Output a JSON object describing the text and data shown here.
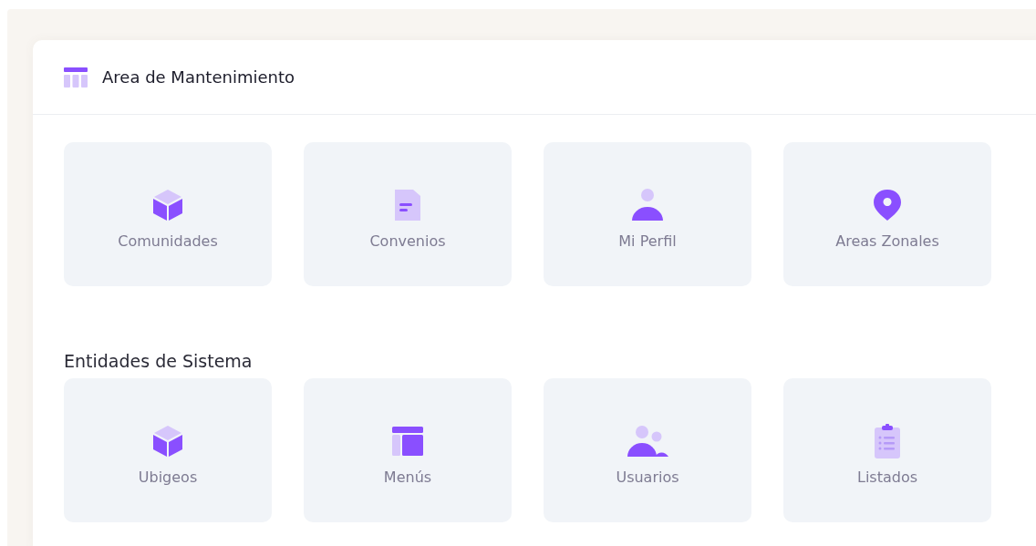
{
  "card": {
    "title": "Area de Mantenimiento"
  },
  "sections": [
    {
      "tiles": [
        {
          "label": "Comunidades",
          "kind": "cube"
        },
        {
          "label": "Convenios",
          "kind": "document"
        },
        {
          "label": "Mi Perfil",
          "kind": "person"
        },
        {
          "label": "Areas Zonales",
          "kind": "pin"
        }
      ]
    },
    {
      "title": "Entidades de Sistema",
      "tiles": [
        {
          "label": "Ubigeos",
          "kind": "cube"
        },
        {
          "label": "Menús",
          "kind": "layout"
        },
        {
          "label": "Usuarios",
          "kind": "people"
        },
        {
          "label": "Listados",
          "kind": "clipboard"
        }
      ]
    }
  ]
}
